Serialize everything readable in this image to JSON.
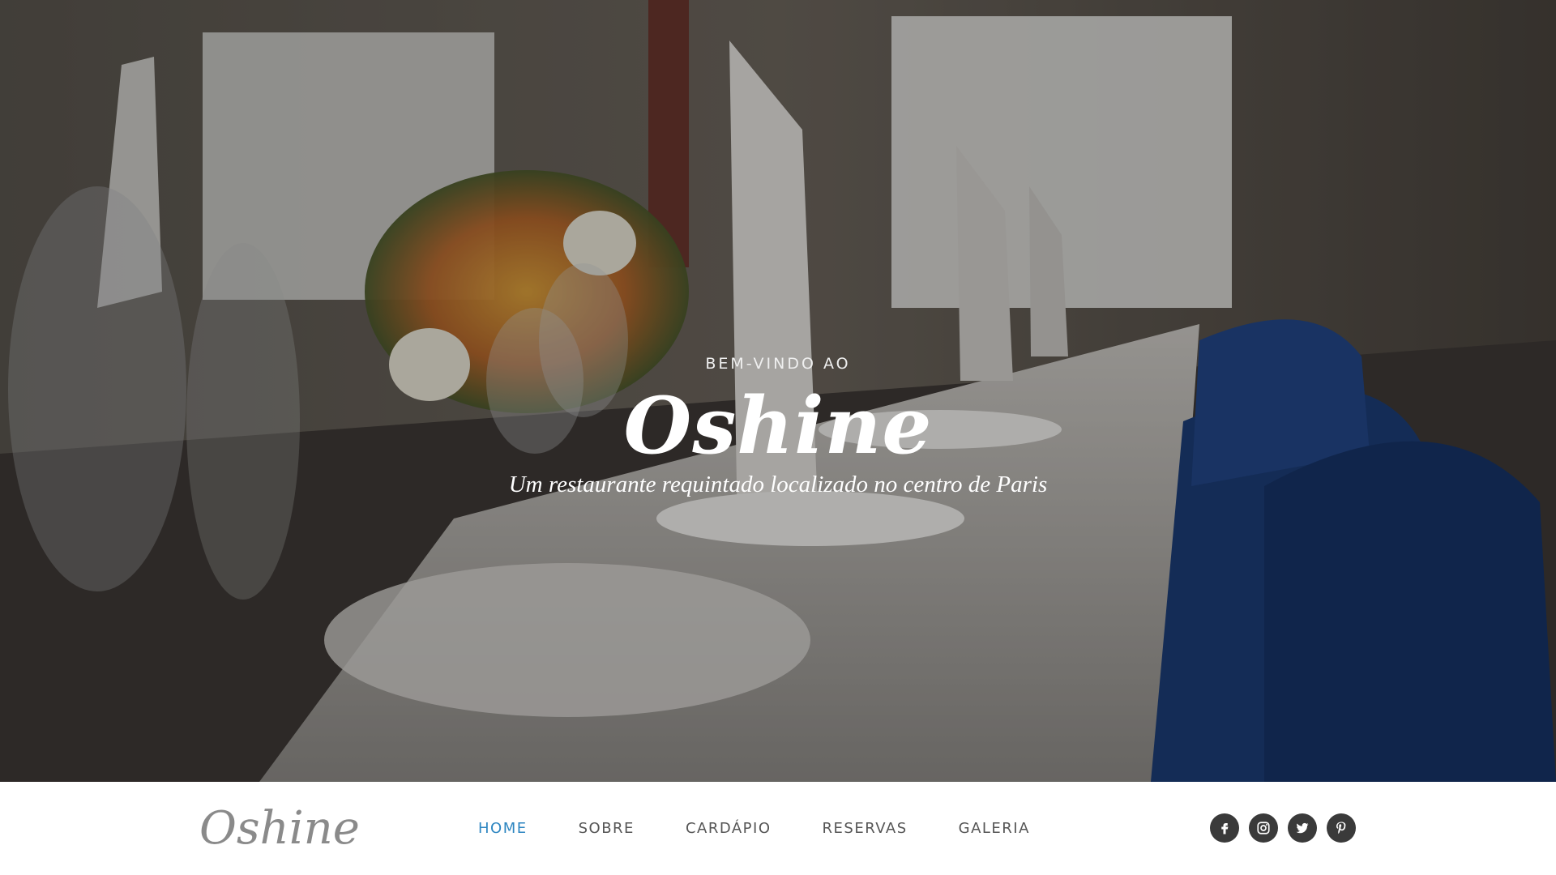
{
  "hero": {
    "kicker": "BEM-VINDO AO",
    "title": "Oshine",
    "tagline": "Um restaurante requintado localizado no centro de Paris"
  },
  "navbar": {
    "logo": "Oshine",
    "menu": [
      {
        "label": "HOME",
        "active": true
      },
      {
        "label": "SOBRE",
        "active": false
      },
      {
        "label": "CARDÁPIO",
        "active": false
      },
      {
        "label": "RESERVAS",
        "active": false
      },
      {
        "label": "GALERIA",
        "active": false
      }
    ],
    "social": [
      "facebook-icon",
      "instagram-icon",
      "twitter-icon",
      "pinterest-icon"
    ]
  },
  "colors": {
    "accent": "#2e86c1",
    "menu_text": "#555555",
    "logo": "#8a8a8a",
    "social_bg": "#3a3a3a"
  }
}
